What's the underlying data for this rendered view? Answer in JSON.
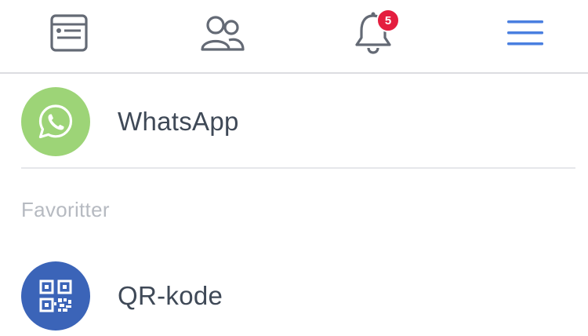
{
  "nav": {
    "items": [
      {
        "icon": "news-feed-icon"
      },
      {
        "icon": "friends-icon"
      },
      {
        "icon": "notifications-bell-icon",
        "badge": "5"
      },
      {
        "icon": "hamburger-menu-icon"
      }
    ],
    "accent_color": "#4a7fe0",
    "badge_color": "#e41e3f"
  },
  "menu": {
    "whatsapp": {
      "label": "WhatsApp",
      "icon": "whatsapp-icon",
      "color": "#9dd477"
    },
    "section_header": "Favoritter",
    "qr": {
      "label": "QR-kode",
      "icon": "qr-code-icon",
      "color": "#3b64b8"
    }
  }
}
